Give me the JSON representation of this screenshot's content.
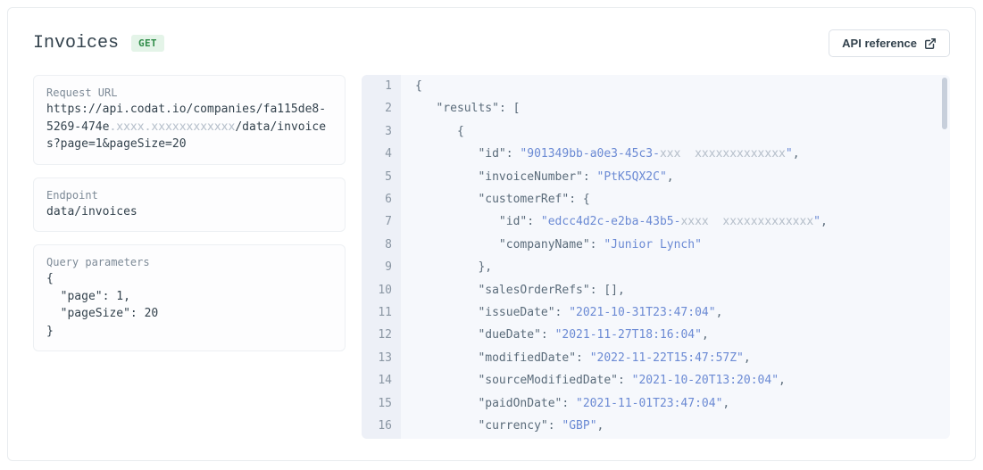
{
  "header": {
    "title": "Invoices",
    "method_badge": "GET",
    "api_reference_label": "API reference"
  },
  "request_url": {
    "label": "Request URL",
    "prefix": "https://api.codat.io/companies/fa115de8-5269-474e",
    "redacted": ".xxxx.xxxxxxxxxxxx",
    "suffix": "/data/invoices?page=1&pageSize=20"
  },
  "endpoint": {
    "label": "Endpoint",
    "value": "data/invoices"
  },
  "query_params": {
    "label": "Query parameters",
    "json": "{\n  \"page\": 1,\n  \"pageSize\": 20\n}"
  },
  "response": {
    "lines": [
      {
        "n": 1,
        "indent": 0,
        "tokens": [
          {
            "t": "punct",
            "v": "{"
          }
        ]
      },
      {
        "n": 2,
        "indent": 1,
        "tokens": [
          {
            "t": "key",
            "v": "\"results\""
          },
          {
            "t": "punct",
            "v": ": ["
          }
        ]
      },
      {
        "n": 3,
        "indent": 2,
        "tokens": [
          {
            "t": "punct",
            "v": "{"
          }
        ]
      },
      {
        "n": 4,
        "indent": 3,
        "tokens": [
          {
            "t": "key",
            "v": "\"id\""
          },
          {
            "t": "punct",
            "v": ": "
          },
          {
            "t": "str",
            "v": "\"901349bb-a0e3-45c3-"
          },
          {
            "t": "redacted",
            "v": "xxx  xxxxxxxxxxxxx"
          },
          {
            "t": "str",
            "v": "\""
          },
          {
            "t": "punct",
            "v": ","
          }
        ]
      },
      {
        "n": 5,
        "indent": 3,
        "tokens": [
          {
            "t": "key",
            "v": "\"invoiceNumber\""
          },
          {
            "t": "punct",
            "v": ": "
          },
          {
            "t": "str",
            "v": "\"PtK5QX2C\""
          },
          {
            "t": "punct",
            "v": ","
          }
        ]
      },
      {
        "n": 6,
        "indent": 3,
        "tokens": [
          {
            "t": "key",
            "v": "\"customerRef\""
          },
          {
            "t": "punct",
            "v": ": {"
          }
        ]
      },
      {
        "n": 7,
        "indent": 4,
        "tokens": [
          {
            "t": "key",
            "v": "\"id\""
          },
          {
            "t": "punct",
            "v": ": "
          },
          {
            "t": "str",
            "v": "\"edcc4d2c-e2ba-43b5-"
          },
          {
            "t": "redacted",
            "v": "xxxx  xxxxxxxxxxxxx"
          },
          {
            "t": "str",
            "v": "\""
          },
          {
            "t": "punct",
            "v": ","
          }
        ]
      },
      {
        "n": 8,
        "indent": 4,
        "tokens": [
          {
            "t": "key",
            "v": "\"companyName\""
          },
          {
            "t": "punct",
            "v": ": "
          },
          {
            "t": "str",
            "v": "\"Junior Lynch\""
          }
        ]
      },
      {
        "n": 9,
        "indent": 3,
        "tokens": [
          {
            "t": "punct",
            "v": "},"
          }
        ]
      },
      {
        "n": 10,
        "indent": 3,
        "tokens": [
          {
            "t": "key",
            "v": "\"salesOrderRefs\""
          },
          {
            "t": "punct",
            "v": ": [],"
          }
        ]
      },
      {
        "n": 11,
        "indent": 3,
        "tokens": [
          {
            "t": "key",
            "v": "\"issueDate\""
          },
          {
            "t": "punct",
            "v": ": "
          },
          {
            "t": "str",
            "v": "\"2021-10-31T23:47:04\""
          },
          {
            "t": "punct",
            "v": ","
          }
        ]
      },
      {
        "n": 12,
        "indent": 3,
        "tokens": [
          {
            "t": "key",
            "v": "\"dueDate\""
          },
          {
            "t": "punct",
            "v": ": "
          },
          {
            "t": "str",
            "v": "\"2021-11-27T18:16:04\""
          },
          {
            "t": "punct",
            "v": ","
          }
        ]
      },
      {
        "n": 13,
        "indent": 3,
        "tokens": [
          {
            "t": "key",
            "v": "\"modifiedDate\""
          },
          {
            "t": "punct",
            "v": ": "
          },
          {
            "t": "str",
            "v": "\"2022-11-22T15:47:57Z\""
          },
          {
            "t": "punct",
            "v": ","
          }
        ]
      },
      {
        "n": 14,
        "indent": 3,
        "tokens": [
          {
            "t": "key",
            "v": "\"sourceModifiedDate\""
          },
          {
            "t": "punct",
            "v": ": "
          },
          {
            "t": "str",
            "v": "\"2021-10-20T13:20:04\""
          },
          {
            "t": "punct",
            "v": ","
          }
        ]
      },
      {
        "n": 15,
        "indent": 3,
        "tokens": [
          {
            "t": "key",
            "v": "\"paidOnDate\""
          },
          {
            "t": "punct",
            "v": ": "
          },
          {
            "t": "str",
            "v": "\"2021-11-01T23:47:04\""
          },
          {
            "t": "punct",
            "v": ","
          }
        ]
      },
      {
        "n": 16,
        "indent": 3,
        "tokens": [
          {
            "t": "key",
            "v": "\"currency\""
          },
          {
            "t": "punct",
            "v": ": "
          },
          {
            "t": "str",
            "v": "\"GBP\""
          },
          {
            "t": "punct",
            "v": ","
          }
        ]
      }
    ]
  }
}
